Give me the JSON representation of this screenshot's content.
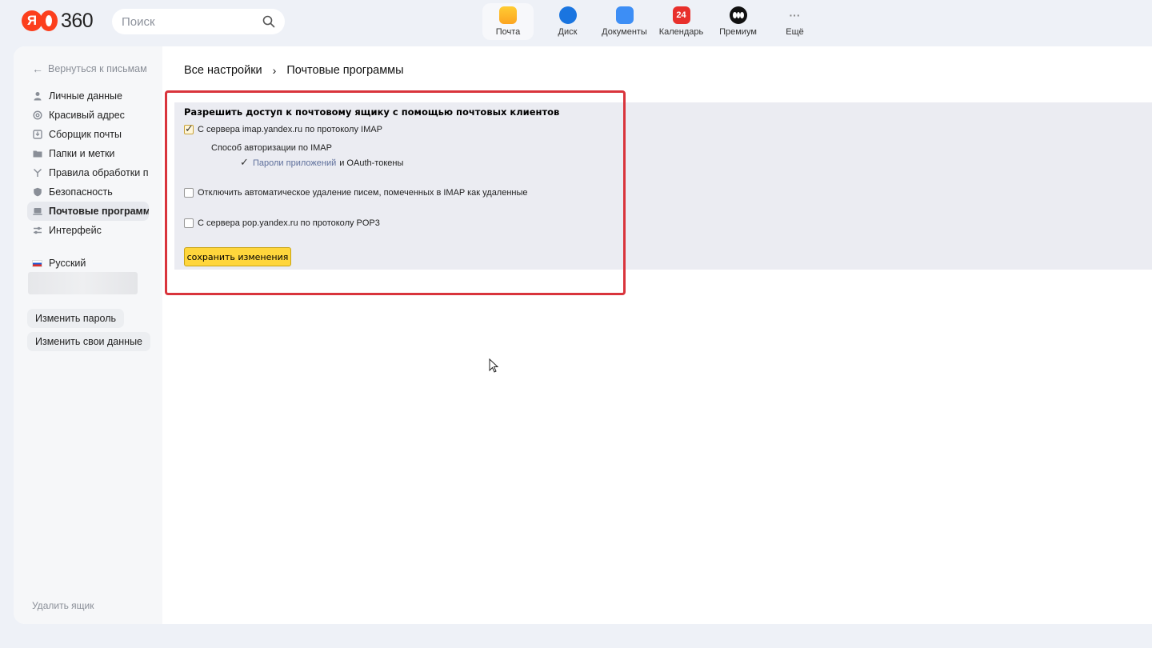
{
  "header": {
    "search_placeholder": "Поиск",
    "apps": [
      {
        "label": "Почта",
        "icon": "mail-icon",
        "color": "#fcb42a"
      },
      {
        "label": "Диск",
        "icon": "disk-icon",
        "color": "#1a75e0"
      },
      {
        "label": "Документы",
        "icon": "documents-icon",
        "color": "#3d8ef5"
      },
      {
        "label": "Календарь",
        "icon": "calendar-icon",
        "color": "#e8302c",
        "badge": "24"
      },
      {
        "label": "Премиум",
        "icon": "premium-icon",
        "color": "#111111"
      },
      {
        "label": "Ещё",
        "icon": "more-icon",
        "glyph": "···"
      }
    ],
    "logo_num": "360",
    "logo_letter": "Я"
  },
  "sidebar": {
    "back": "Вернуться к письмам",
    "items": [
      {
        "label": "Личные данные",
        "icon": "person-icon"
      },
      {
        "label": "Красивый адрес",
        "icon": "at-icon"
      },
      {
        "label": "Сборщик почты",
        "icon": "inbox-download-icon"
      },
      {
        "label": "Папки и метки",
        "icon": "folder-icon"
      },
      {
        "label": "Правила обработки писем",
        "icon": "rules-icon"
      },
      {
        "label": "Безопасность",
        "icon": "shield-icon"
      },
      {
        "label": "Почтовые программы",
        "icon": "laptop-icon",
        "active": true
      },
      {
        "label": "Интерфейс",
        "icon": "sliders-icon"
      }
    ],
    "language": "Русский",
    "change_password": "Изменить пароль",
    "change_data": "Изменить свои данные",
    "delete_box": "Удалить ящик"
  },
  "main": {
    "breadcrumb": {
      "root": "Все настройки",
      "sep": "›",
      "current": "Почтовые программы"
    },
    "form": {
      "title": "Разрешить доступ к почтовому ящику с помощью почтовых клиентов",
      "imap": {
        "label": "С сервера imap.yandex.ru по протоколу IMAP",
        "checked": true
      },
      "auth_title": "Способ авторизации по IMAP",
      "auth_link": "Пароли приложений",
      "auth_rest": "и OAuth-токены",
      "auth_checked": true,
      "disable_delete": {
        "label": "Отключить автоматическое удаление писем, помеченных в IMAP как удаленные",
        "checked": false
      },
      "pop3": {
        "label": "С сервера pop.yandex.ru по протоколу POP3",
        "checked": false
      },
      "save": "сохранить изменения"
    }
  }
}
